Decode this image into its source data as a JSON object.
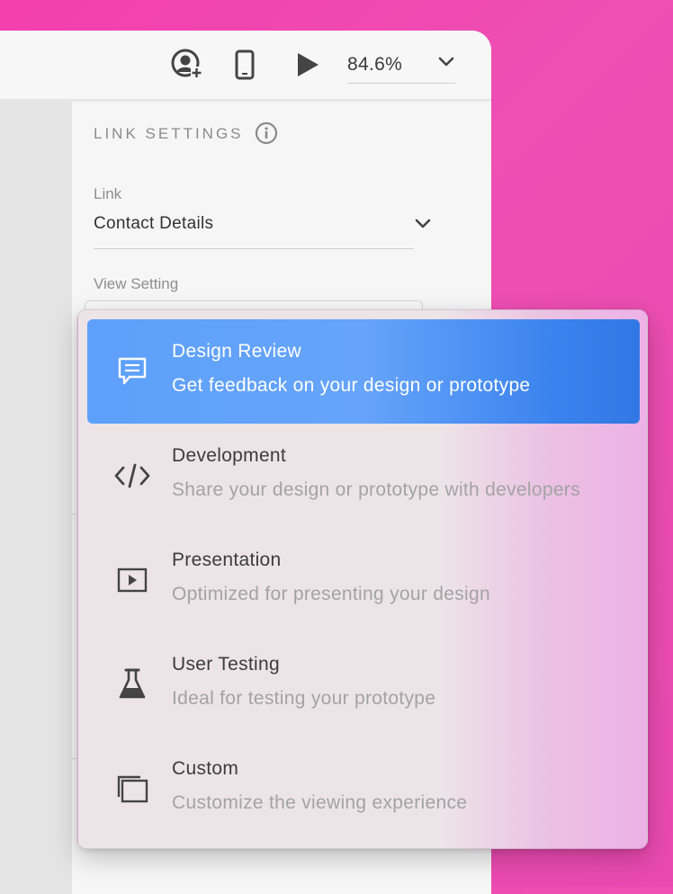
{
  "toolbar": {
    "zoom_value": "84.6%",
    "icons": [
      "add-user-icon",
      "mobile-device-icon",
      "play-icon",
      "chevron-down-icon"
    ]
  },
  "panel": {
    "title": "LINK SETTINGS",
    "link_label": "Link",
    "link_value": "Contact Details",
    "view_setting_label": "View Setting"
  },
  "view_menu": {
    "items": [
      {
        "title": "Design Review",
        "subtitle": "Get feedback on your design or prototype",
        "icon": "comment-icon",
        "selected": true
      },
      {
        "title": "Development",
        "subtitle": "Share your design or prototype with developers",
        "icon": "code-icon",
        "selected": false
      },
      {
        "title": "Presentation",
        "subtitle": "Optimized for presenting your design",
        "icon": "play-box-icon",
        "selected": false
      },
      {
        "title": "User Testing",
        "subtitle": "Ideal for testing your prototype",
        "icon": "flask-icon",
        "selected": false
      },
      {
        "title": "Custom",
        "subtitle": "Customize the viewing experience",
        "icon": "stacked-windows-icon",
        "selected": false
      }
    ]
  },
  "colors": {
    "background": "#f33fae",
    "selected_item": "#5da0fb",
    "panel": "#f6f6f6"
  }
}
